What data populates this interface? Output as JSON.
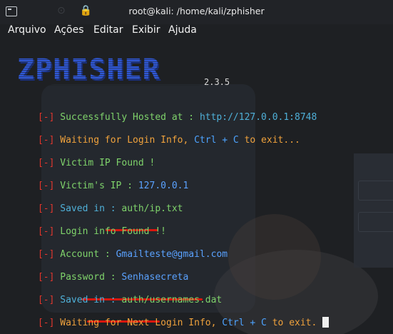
{
  "window": {
    "title": "root@kali: /home/kali/zphisher"
  },
  "menu": [
    "Arquivo",
    "Ações",
    "Editar",
    "Exibir",
    "Ajuda"
  ],
  "banner": {
    "logo": "ZPHISHER",
    "version": "2.3.5"
  },
  "terminal": {
    "prefix": "[-]",
    "hosted_label": "Successfully Hosted at : ",
    "hosted_url": "http://127.0.0.1:8748",
    "waiting_login": "Waiting for Login Info, ",
    "ctrl_c": "Ctrl + C",
    "to_exit_dots": " to exit...",
    "victim_found": "Victim IP Found !",
    "victim_ip_label": "Victim's IP : ",
    "victim_ip": "127.0.0.1",
    "saved_label": "Saved in : ",
    "saved_ip_file": "auth/ip.txt",
    "login_found": "Login info Found !!",
    "account_label": "Account : ",
    "account_value": "Gmailteste@gmail.com",
    "password_label": "Password : ",
    "password_value": "Senhasecreta",
    "saved_label2": "Saved in : ",
    "saved_usernames_file": "auth/usernames.dat",
    "waiting_next": "Waiting for Next Login Info, ",
    "to_exit": " to exit."
  },
  "colors": {
    "prefix": "#e2372e",
    "underline": "#d9160e",
    "logo": "#2f58d8"
  }
}
